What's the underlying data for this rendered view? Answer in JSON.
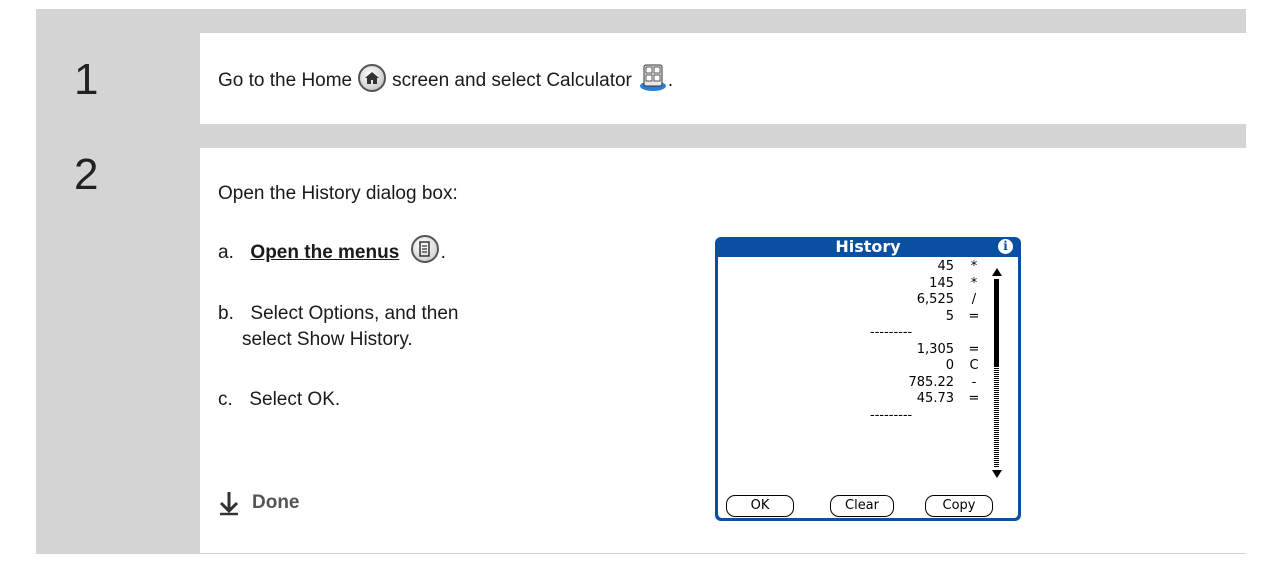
{
  "steps": [
    {
      "number": "1",
      "text_before_home": "Go to the Home",
      "text_after_home": "screen and select Calculator",
      "text_end": ".",
      "icons": [
        "home-icon",
        "calculator-icon"
      ]
    },
    {
      "number": "2",
      "intro": "Open the History dialog box:",
      "a_prefix": "a.",
      "a_link": "Open the menus",
      "a_end": ".",
      "b_prefix": "b.",
      "b_line1": "Select Options, and then",
      "b_line2": "select Show History.",
      "c_prefix": "c.",
      "c_text": "Select OK.",
      "done": "Done"
    }
  ],
  "dialog": {
    "title": "History",
    "info_icon": "i",
    "rows": [
      {
        "value": "45",
        "op": "*"
      },
      {
        "value": "145",
        "op": "*"
      },
      {
        "value": "6,525",
        "op": "/"
      },
      {
        "value": "5",
        "op": "="
      },
      {
        "divider": "---------"
      },
      {
        "value": "1,305",
        "op": "="
      },
      {
        "value": "0",
        "op": "C"
      },
      {
        "value": "785.22",
        "op": "-"
      },
      {
        "value": "45.73",
        "op": "="
      },
      {
        "divider": "---------"
      }
    ],
    "buttons": {
      "ok": "OK",
      "clear": "Clear",
      "copy": "Copy"
    },
    "colors": {
      "titlebar": "#0a4fa0"
    }
  },
  "colors": {
    "frame": "#d4d4d4"
  }
}
